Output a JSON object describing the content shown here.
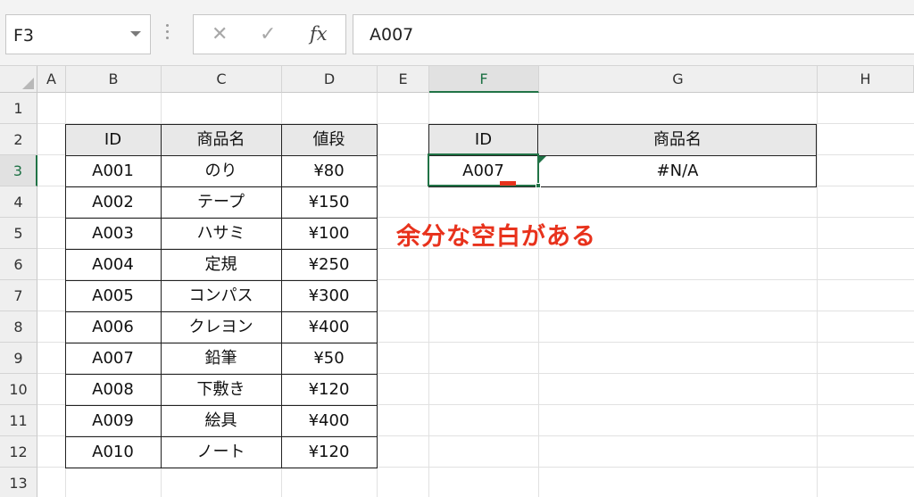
{
  "formula_bar": {
    "name_box": "F3",
    "formula": "A007",
    "fx_label": "fx",
    "cancel_icon": "close-icon",
    "enter_icon": "checkmark-icon"
  },
  "columns": [
    "A",
    "B",
    "C",
    "D",
    "E",
    "F",
    "G",
    "H"
  ],
  "rows": [
    "1",
    "2",
    "3",
    "4",
    "5",
    "6",
    "7",
    "8",
    "9",
    "10",
    "11",
    "12",
    "13"
  ],
  "selected_column": "F",
  "selected_row": "3",
  "product_table": {
    "headers": [
      "ID",
      "商品名",
      "値段"
    ],
    "rows": [
      [
        "A001",
        "のり",
        "¥80"
      ],
      [
        "A002",
        "テープ",
        "¥150"
      ],
      [
        "A003",
        "ハサミ",
        "¥100"
      ],
      [
        "A004",
        "定規",
        "¥250"
      ],
      [
        "A005",
        "コンパス",
        "¥300"
      ],
      [
        "A006",
        "クレヨン",
        "¥400"
      ],
      [
        "A007",
        "鉛筆",
        "¥50"
      ],
      [
        "A008",
        "下敷き",
        "¥120"
      ],
      [
        "A009",
        "絵具",
        "¥400"
      ],
      [
        "A010",
        "ノート",
        "¥120"
      ]
    ]
  },
  "lookup_table": {
    "headers": [
      "ID",
      "商品名"
    ],
    "id_value": "A007",
    "result": "#N/A"
  },
  "annotation": "余分な空白がある",
  "colors": {
    "accent_green": "#217346",
    "annotation_red": "#e8321c",
    "header_fill": "#e8e8e8"
  }
}
